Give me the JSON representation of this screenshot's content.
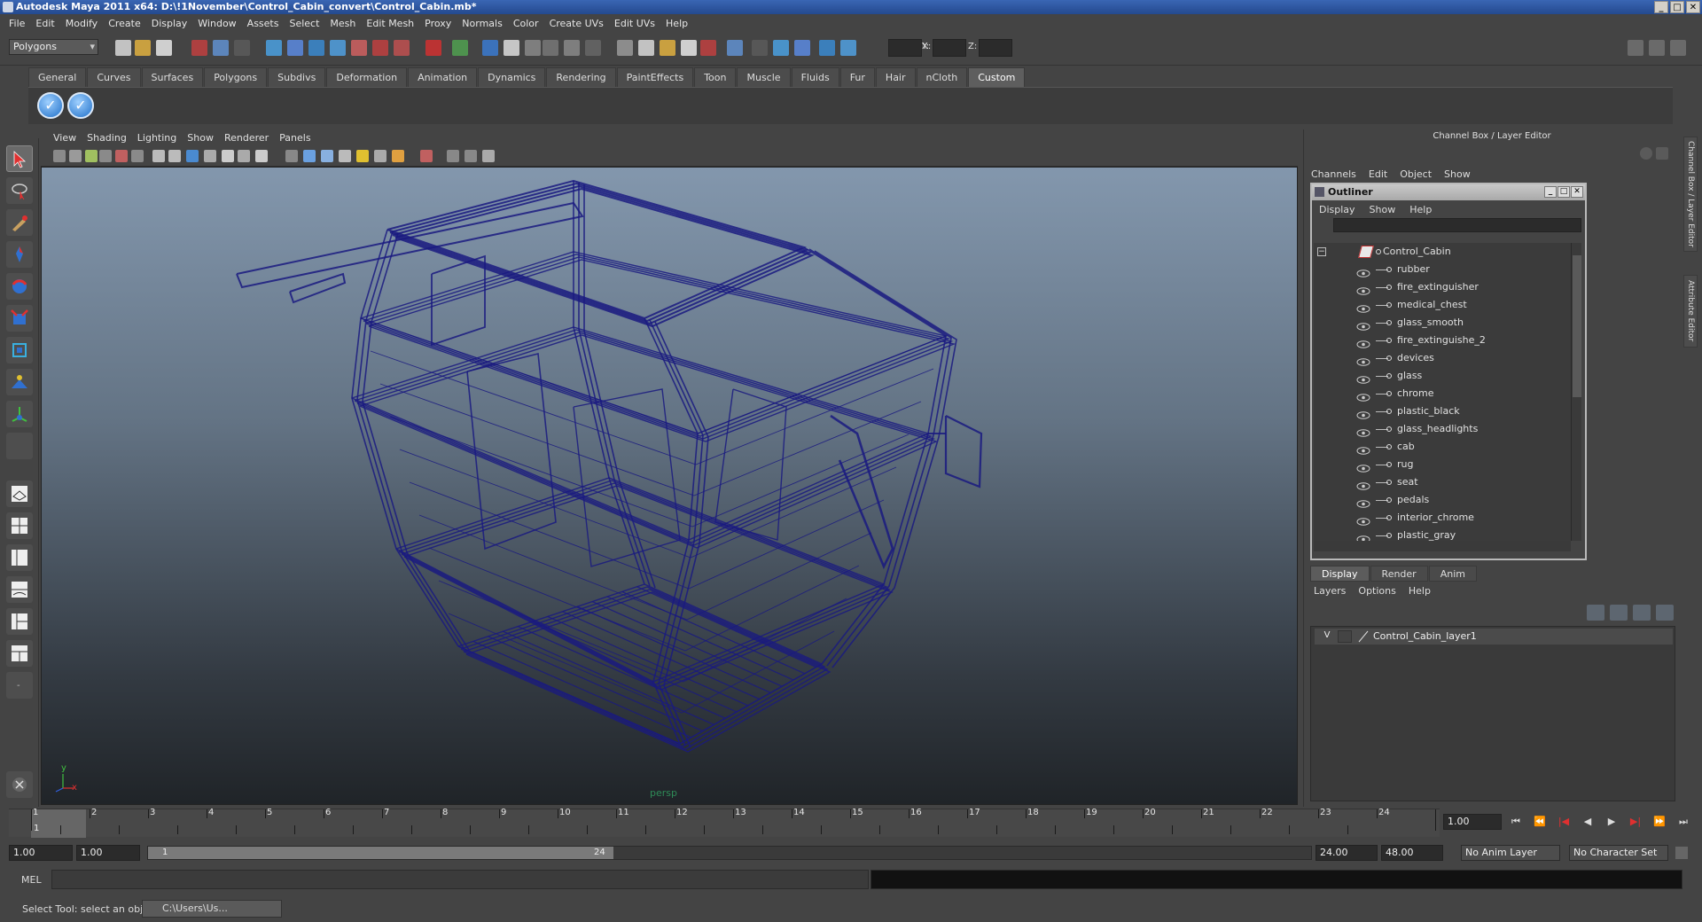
{
  "window": {
    "title": "Autodesk Maya 2011 x64: D:\\!1November\\Control_Cabin_convert\\Control_Cabin.mb*"
  },
  "menubar": [
    "File",
    "Edit",
    "Modify",
    "Create",
    "Display",
    "Window",
    "Assets",
    "Select",
    "Mesh",
    "Edit Mesh",
    "Proxy",
    "Normals",
    "Color",
    "Create UVs",
    "Edit UVs",
    "Help"
  ],
  "statusline": {
    "mode": "Polygons",
    "x_label": "X:",
    "y_label": "Y:",
    "z_label": "Z:"
  },
  "shelf": {
    "tabs": [
      "General",
      "Curves",
      "Surfaces",
      "Polygons",
      "Subdivs",
      "Deformation",
      "Animation",
      "Dynamics",
      "Rendering",
      "PaintEffects",
      "Toon",
      "Muscle",
      "Fluids",
      "Fur",
      "Hair",
      "nCloth",
      "Custom"
    ],
    "active_tab": "Custom"
  },
  "viewport": {
    "menu": [
      "View",
      "Shading",
      "Lighting",
      "Show",
      "Renderer",
      "Panels"
    ],
    "camera_label": "persp",
    "axis_y": "y",
    "axis_x": "x"
  },
  "channel_box": {
    "title": "Channel Box / Layer Editor",
    "menu": [
      "Channels",
      "Edit",
      "Object",
      "Show"
    ]
  },
  "outliner": {
    "title": "Outliner",
    "menu": [
      "Display",
      "Show",
      "Help"
    ],
    "root": "Control_Cabin",
    "items": [
      "rubber",
      "fire_extinguisher",
      "medical_chest",
      "glass_smooth",
      "fire_extinguishe_2",
      "devices",
      "glass",
      "chrome",
      "plastic_black",
      "glass_headlights",
      "cab",
      "rug",
      "seat",
      "pedals",
      "interior_chrome",
      "plastic_gray"
    ]
  },
  "layer_editor": {
    "tabs": [
      "Display",
      "Render",
      "Anim"
    ],
    "active_tab": "Display",
    "menu": [
      "Layers",
      "Options",
      "Help"
    ],
    "layers": [
      {
        "visible": "V",
        "name": "Control_Cabin_layer1"
      }
    ]
  },
  "side_tabs": [
    "Channel Box / Layer Editor",
    "Attribute Editor"
  ],
  "timeline": {
    "ticks": [
      "1",
      "2",
      "3",
      "4",
      "5",
      "6",
      "7",
      "8",
      "9",
      "10",
      "11",
      "12",
      "13",
      "14",
      "15",
      "16",
      "17",
      "18",
      "19",
      "20",
      "21",
      "22",
      "23",
      "24"
    ],
    "current_frame_label": "1",
    "current_time": "1.00"
  },
  "range": {
    "start": "1.00",
    "playback_start": "1.00",
    "slider_start": "1",
    "slider_end": "24",
    "playback_end": "24.00",
    "end": "48.00",
    "anim_layer": "No Anim Layer",
    "character_set": "No Character Set"
  },
  "command_line": {
    "label": "MEL"
  },
  "help_line": {
    "text": "Select Tool: select an object",
    "task": "C:\\Users\\Us..."
  },
  "colors": {
    "wireframe": "#1a1a80",
    "viewport_top": "#8397ad",
    "viewport_bottom": "#202428",
    "title_bar": "#2f5aa6"
  }
}
